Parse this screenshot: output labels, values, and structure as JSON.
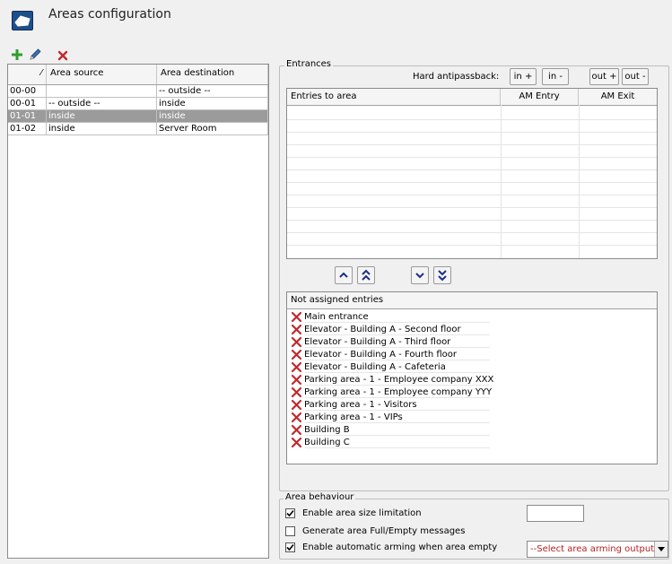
{
  "window": {
    "title": "Areas configuration"
  },
  "toolbar": {
    "add_icon": "plus-icon",
    "edit_icon": "pencil-icon",
    "delete_icon": "close-icon"
  },
  "areas_grid": {
    "sort_glyph": "⁄",
    "columns": [
      "Area source",
      "Area destination"
    ],
    "rows": [
      {
        "id": "00-00",
        "source": "",
        "destination": "-- outside --",
        "selected": false
      },
      {
        "id": "00-01",
        "source": "-- outside --",
        "destination": "inside",
        "selected": false
      },
      {
        "id": "01-01",
        "source": "inside",
        "destination": "inside",
        "selected": true
      },
      {
        "id": "01-02",
        "source": "inside",
        "destination": "Server Room",
        "selected": false
      }
    ]
  },
  "entrances": {
    "legend": "Entrances",
    "hard_antipassback_label": "Hard antipassback:",
    "buttons": {
      "in_plus": "in +",
      "in_minus": "in -",
      "out_plus": "out +",
      "out_minus": "out -"
    },
    "entries_columns": [
      "Entries to area",
      "AM Entry",
      "AM Exit"
    ],
    "entries": [],
    "move_buttons": [
      "up-icon",
      "double-up-icon",
      "down-icon",
      "double-down-icon"
    ],
    "not_assigned_header": "Not assigned entries",
    "not_assigned": [
      "Main entrance",
      "Elevator - Building A - Second floor",
      "Elevator - Building A - Third floor",
      "Elevator - Building A - Fourth floor",
      "Elevator - Building A - Cafeteria",
      "Parking area - 1 - Employee company XXX",
      "Parking area - 1 - Employee company YYY",
      "Parking area - 1 - Visitors",
      "Parking area - 1 - VIPs",
      "Building B",
      "Building C"
    ]
  },
  "behaviour": {
    "legend": "Area behaviour",
    "enable_size_limit": {
      "label": "Enable area size limitation",
      "checked": true,
      "value": ""
    },
    "generate_messages": {
      "label": "Generate area Full/Empty messages",
      "checked": false
    },
    "auto_arming": {
      "label": "Enable automatic arming when area empty",
      "checked": true
    },
    "arming_output": {
      "selected": "--Select area arming output--"
    }
  },
  "colors": {
    "accent": "#1f4f8a",
    "selected_row": "#9b9b9b",
    "delete_red": "#c0282d",
    "add_green": "#2e9e2e"
  }
}
